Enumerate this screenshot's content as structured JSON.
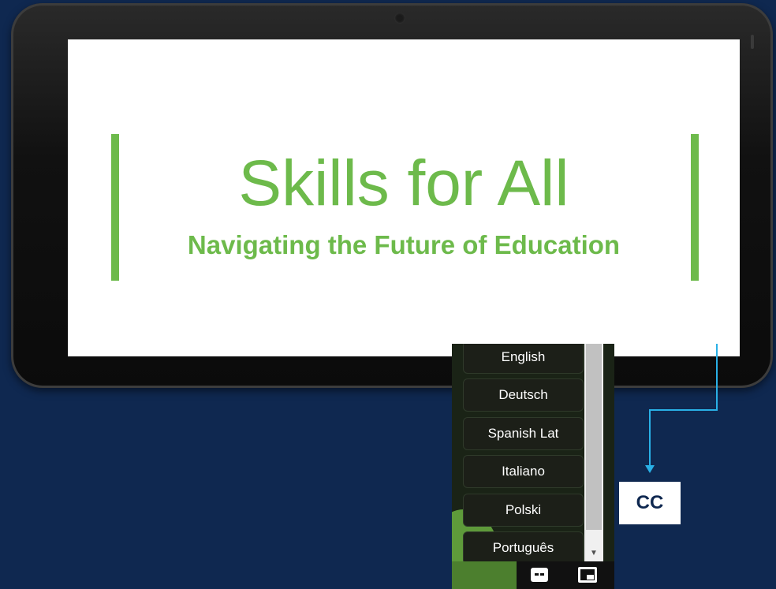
{
  "slide": {
    "title": "Skills for All",
    "subtitle": "Navigating the Future of Education"
  },
  "caption_menu": {
    "languages": [
      "English",
      "Deutsch",
      "Spanish Lat",
      "Italiano",
      "Polski",
      "Português"
    ]
  },
  "callout": {
    "label": "CC"
  },
  "controls": {
    "cc_icon": "closed-captions-icon",
    "pip_icon": "picture-in-picture-icon"
  },
  "colors": {
    "background": "#0f2850",
    "accent_green": "#6dba4b",
    "connector": "#29b0e6"
  }
}
